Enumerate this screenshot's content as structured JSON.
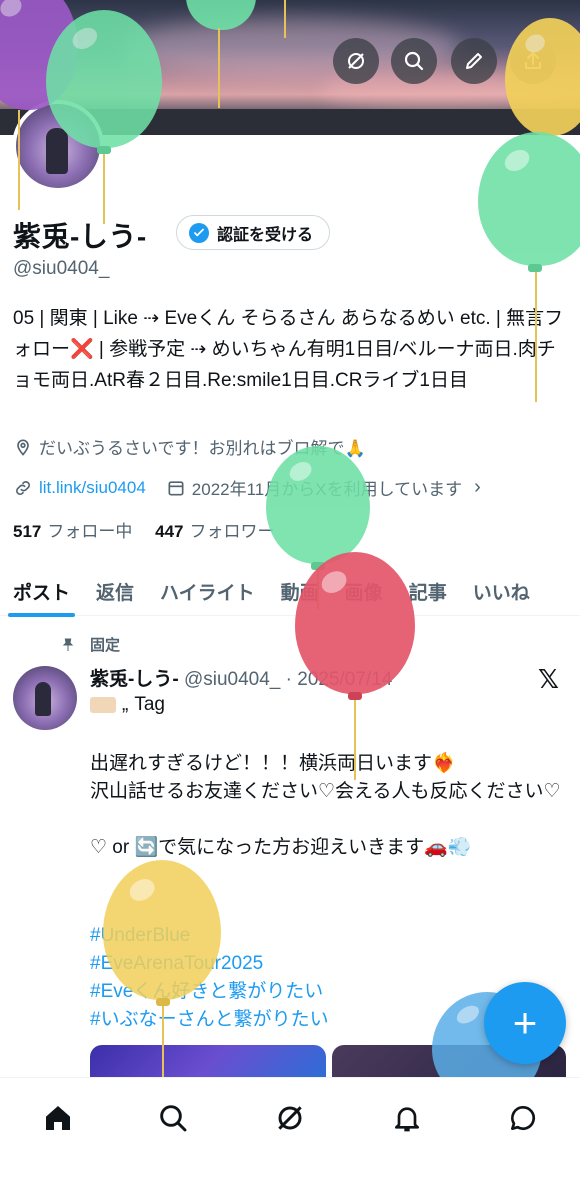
{
  "header": {
    "buttons": [
      {
        "name": "explore-icon"
      },
      {
        "name": "search-icon"
      },
      {
        "name": "edit-icon"
      },
      {
        "name": "share-icon"
      }
    ]
  },
  "profile": {
    "name": "紫兎-しう-",
    "verify_label": "認証を受ける",
    "handle": "@siu0404_",
    "bio": "05 | 関東 | Like ⇢ Eveくん そらるさん あらなるめい etc. | 無言フォロー❌ | 参戦予定 ⇢ めいちゃん有明1日目/ベルーナ両日.肉チョモ両日.AtR春２日目.Re:smile1日目.CRライブ1日目",
    "location": "だいぶうるさいです！お別れはブロ解で🙏",
    "link": "lit.link/siu0404",
    "joined": "2022年11月からXを利用しています",
    "following_count": "517",
    "following_label": "フォロー中",
    "followers_count": "447",
    "followers_label": "フォロワー"
  },
  "tabs": [
    {
      "label": "ポスト",
      "active": true
    },
    {
      "label": "返信"
    },
    {
      "label": "ハイライト"
    },
    {
      "label": "動画"
    },
    {
      "label": "画像"
    },
    {
      "label": "記事"
    },
    {
      "label": "いいね"
    }
  ],
  "pinned_post": {
    "pinned_label": "固定",
    "author_name": "紫兎-しう-",
    "author_handle": "@siu0404_",
    "date": "2025/07/14",
    "tag_label": "Tag",
    "lines": [
      "出遅れすぎるけど！！！横浜両日います❤️‍🔥",
      "沢山話せるお友達ください♡会える人も反応ください♡",
      "",
      "♡ or 🔄で気になった方お迎えいきます🚗💨"
    ],
    "hashtags": [
      "#UnderBlue",
      "#EveArenaTour2025",
      "#Eveくん好きと繋がりたい",
      "#いぶなーさんと繋がりたい"
    ]
  },
  "fab_label": "+",
  "bottom_nav": [
    {
      "name": "home-icon"
    },
    {
      "name": "search-icon"
    },
    {
      "name": "grok-icon"
    },
    {
      "name": "notifications-icon"
    },
    {
      "name": "messages-icon"
    }
  ],
  "colors": {
    "accent": "#1d9bf0",
    "text_primary": "#0f1419",
    "text_secondary": "#536471",
    "balloon_green": "#6ee0a6",
    "balloon_red": "#e4566a",
    "balloon_yellow": "#f2d05a",
    "balloon_purple": "#9b59c6",
    "balloon_blue": "#5aaee8"
  }
}
